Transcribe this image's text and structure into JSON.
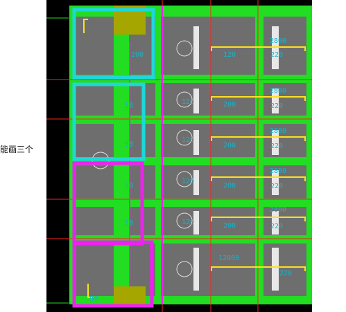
{
  "side_text": "能画三个",
  "colors": {
    "canvas": "#000000",
    "slab": "#6e6e6e",
    "beam": "#22dd22",
    "cyan_box": "#1ed8d8",
    "magenta_box": "#ee22ee",
    "yellow_block": "#a6a600",
    "dim_text": "#19b3c8",
    "red_line": "#ff2020",
    "dim_yellow": "#ffe020"
  },
  "labels": {
    "left_rebar": [
      "50",
      "50",
      "50",
      "50",
      "50"
    ],
    "mid_rebar": [
      "200",
      "120",
      "120",
      "200",
      "120",
      "200",
      "120",
      "200",
      "120",
      "200"
    ],
    "right_top": [
      "2800",
      "2800",
      "2800",
      "2800",
      "2800"
    ],
    "right_bottom": [
      "220",
      "220",
      "220",
      "220",
      "220"
    ],
    "bottom_label": "12800",
    "bottom_right": "220"
  }
}
